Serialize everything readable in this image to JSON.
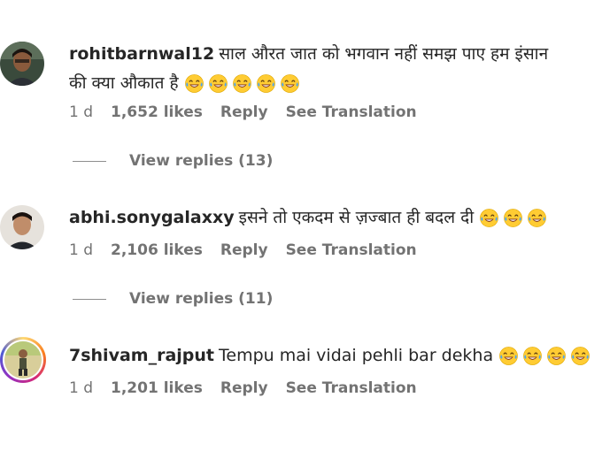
{
  "comments": [
    {
      "username": "rohitbarnwal12",
      "text_line1": "साल औरत जात को भगवान नहीं समझ पाए हम इंसान",
      "text_line2": "की क्या औकात है",
      "emoji_count": 5,
      "emoji_icon": "laughing-tears-emoji",
      "age": "1 d",
      "likes": "1,652 likes",
      "reply": "Reply",
      "translate": "See Translation",
      "view_replies": "View replies (13)",
      "avatar_story": false
    },
    {
      "username": "abhi.sonygalaxxy",
      "text_line1": "इसने तो एकदम से ज़ज्बात ही बदल दी",
      "emoji_count": 3,
      "emoji_icon": "laughing-tears-emoji",
      "age": "1 d",
      "likes": "2,106 likes",
      "reply": "Reply",
      "translate": "See Translation",
      "view_replies": "View replies (11)",
      "avatar_story": false
    },
    {
      "username": "7shivam_rajput",
      "text_line1": "Tempu mai vidai pehli bar dekha",
      "emoji_count": 4,
      "emoji_icon": "laughing-tears-emoji",
      "age": "1 d",
      "likes": "1,201 likes",
      "reply": "Reply",
      "translate": "See Translation",
      "avatar_story": true
    }
  ],
  "colors": {
    "primary_text": "#262626",
    "secondary_text": "#737373",
    "emoji_face": "#ffcc33",
    "emoji_tears": "#4aa3f0"
  }
}
